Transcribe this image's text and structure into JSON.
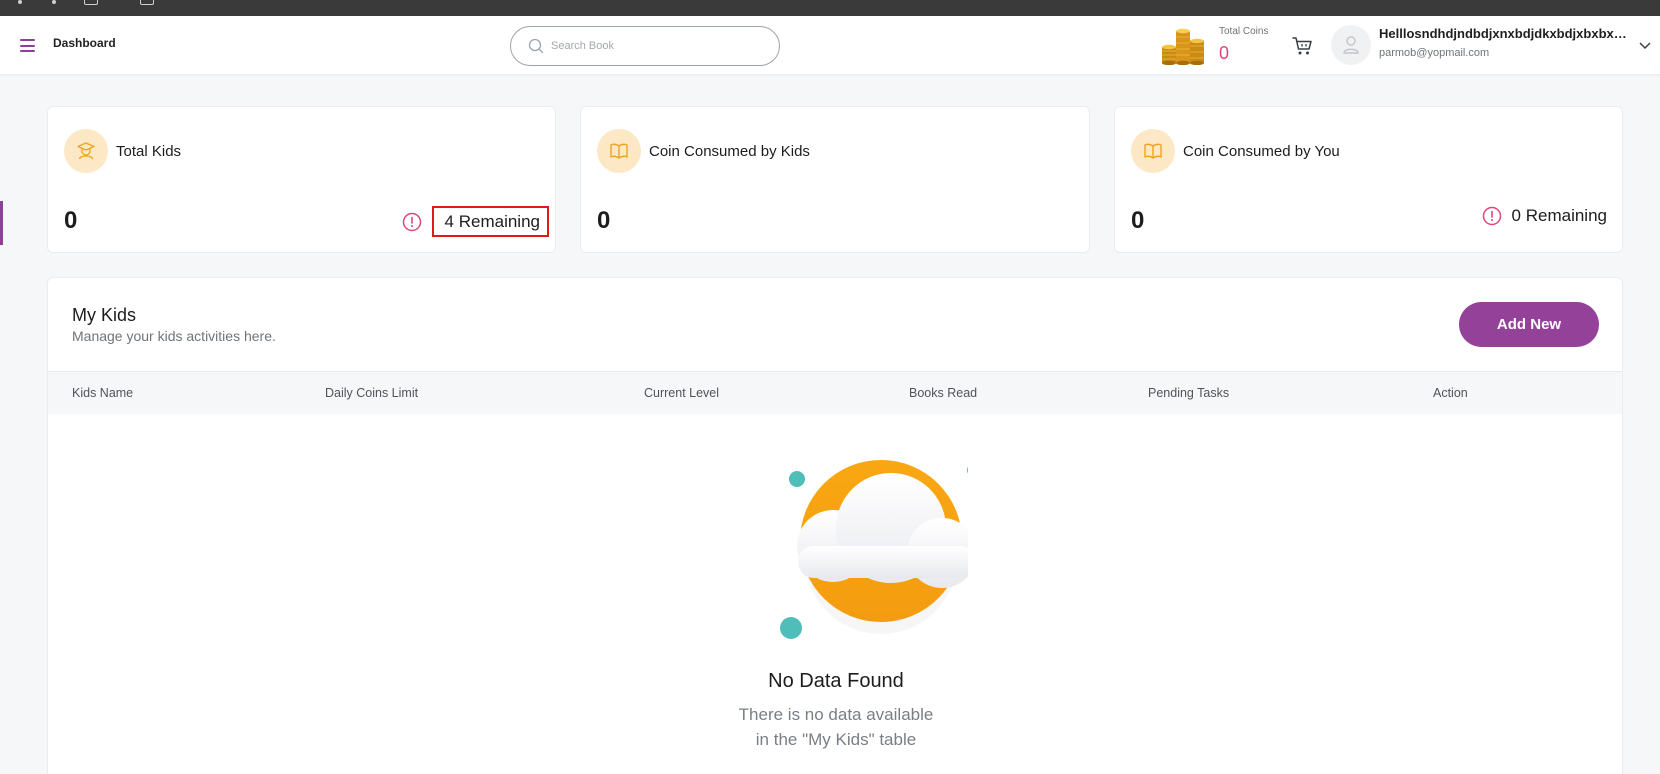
{
  "header": {
    "breadcrumb": "Dashboard",
    "search": {
      "placeholder": "Search Book",
      "value": ""
    },
    "coins": {
      "label": "Total Coins",
      "value": "0"
    },
    "user": {
      "name": "Helllosndhdjndbdjxnxbdjdkxbdjxbxbxbxbx",
      "email": "parmob@yopmail.com"
    }
  },
  "cards": [
    {
      "title": "Total Kids",
      "value": "0",
      "remaining": "4 Remaining",
      "icon": "graduate-icon"
    },
    {
      "title": "Coin Consumed by Kids",
      "value": "0",
      "icon": "book-icon"
    },
    {
      "title": "Coin Consumed by You",
      "value": "0",
      "remaining": "0 Remaining",
      "icon": "book-icon"
    }
  ],
  "my_kids": {
    "title": "My Kids",
    "subtitle": "Manage your kids activities here.",
    "add_label": "Add New",
    "columns": [
      "Kids Name",
      "Daily Coins Limit",
      "Current Level",
      "Books Read",
      "Pending Tasks",
      "Action"
    ],
    "empty_title": "No Data Found",
    "empty_text": "There is no data available in the \"My Kids\" table"
  },
  "colors": {
    "accent": "#944199",
    "coin_value": "#e0457b",
    "alert": "#e0457b",
    "highlight_box": "#e01919",
    "icon_bg": "#fde8c6",
    "icon_fg": "#f0a321"
  }
}
